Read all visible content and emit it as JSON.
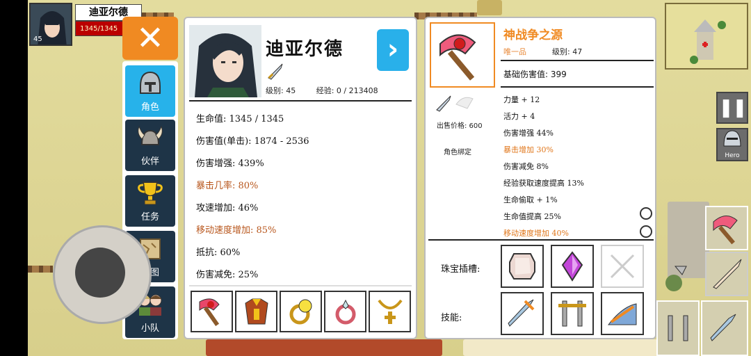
{
  "hud": {
    "hero_name": "迪亚尔德",
    "level": "45",
    "hp_text": "1345/1345"
  },
  "side_tabs": [
    {
      "label": "角色",
      "icon": "helmet-icon",
      "active": true
    },
    {
      "label": "伙伴",
      "icon": "viking-helmet-icon",
      "active": false
    },
    {
      "label": "任务",
      "icon": "trophy-icon",
      "active": false
    },
    {
      "label": "地图",
      "icon": "map-scroll-icon",
      "active": false
    },
    {
      "label": "小队",
      "icon": "party-icon",
      "active": false
    }
  ],
  "character": {
    "name": "迪亚尔德",
    "level_label": "级别: 45",
    "exp_label": "经验: 0 / 213408",
    "stats": [
      {
        "text": "生命值: 1345 / 1345",
        "highlight": false
      },
      {
        "text": "伤害值(单击): 1874 - 2536",
        "highlight": false
      },
      {
        "text": "伤害增强: 439%",
        "highlight": false
      },
      {
        "text": "暴击几率: 80%",
        "highlight": true
      },
      {
        "text": "攻速增加: 46%",
        "highlight": false
      },
      {
        "text": "移动速度增加: 85%",
        "highlight": true
      },
      {
        "text": "抵抗: 60%",
        "highlight": false
      },
      {
        "text": "伤害减免: 25%",
        "highlight": false
      }
    ],
    "equipment": [
      "axe-icon",
      "armor-icon",
      "ring-icon",
      "amulet-icon",
      "necklace-icon"
    ]
  },
  "item": {
    "name": "神战争之源",
    "unique_label": "唯一品",
    "level_label": "级别: 47",
    "base_damage": "基础伤害值: 399",
    "sell_price": "出售价格: 600",
    "binding": "角色绑定",
    "attributes": [
      {
        "text": "力量 + 12",
        "highlight": false
      },
      {
        "text": "活力 + 4",
        "highlight": false
      },
      {
        "text": "伤害增强 44%",
        "highlight": false
      },
      {
        "text": "暴击增加 30%",
        "highlight": true
      },
      {
        "text": "伤害减免 8%",
        "highlight": false
      },
      {
        "text": "经验获取速度提高 13%",
        "highlight": false
      },
      {
        "text": "生命偷取 + 1%",
        "highlight": false
      },
      {
        "text": "生命值提高 25%",
        "highlight": false
      },
      {
        "text": "移动速度增加 40%",
        "highlight": true
      }
    ],
    "gem_label": "珠宝插槽:",
    "skill_label": "技能:"
  },
  "right_hud": {
    "hero_button": "Hero"
  },
  "colors": {
    "accent_orange": "#f08a22",
    "accent_blue": "#29b0ea",
    "highlight_text": "#b8561c"
  }
}
